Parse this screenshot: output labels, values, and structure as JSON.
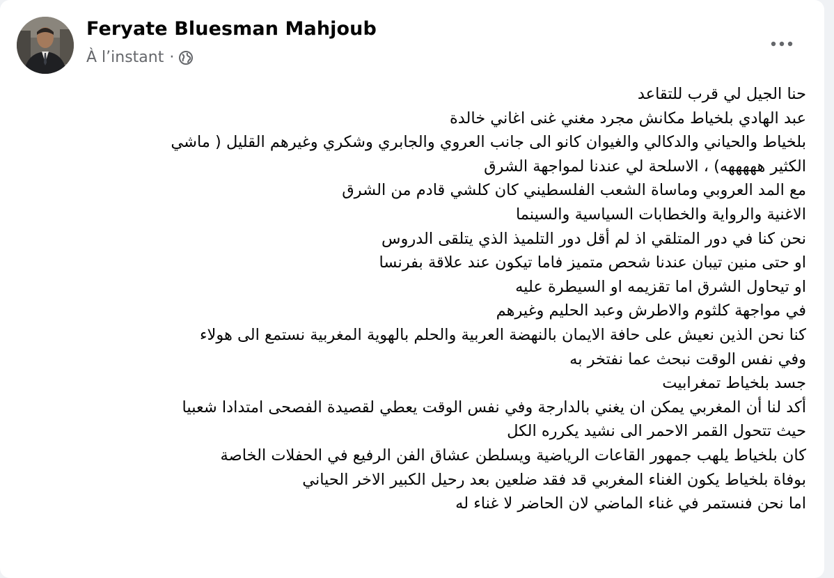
{
  "post": {
    "author": "Feryate Bluesman Mahjoub",
    "timestamp": "À l’instant",
    "separator": "·",
    "audience_icon": "globe-icon",
    "more_icon": "more-horizontal-icon",
    "lines": [
      "حنا الجيل لي قرب للتقاعد",
      "عبد الهادي بلخياط مكانش مجرد مغني غنى اغاني خالدة",
      "بلخياط والحياني والدكالي والغيوان كانو الى جانب العروي والجابري وشكري وغيرهم القليل ( ماشي",
      "الكثير هههههه)  ، الاسلحة لي عندنا لمواجهة الشرق",
      "مع المد العروبي وماساة الشعب الفلسطيني كان كلشي قادم من الشرق",
      "الاغنية والرواية والخطابات السياسية والسينما",
      "نحن كنا في دور المتلقي اذ لم أقل دور التلميذ الذي يتلقى الدروس",
      "او حتى منين تيبان عندنا شحص متميز  فاما تيكون عند علاقة بفرنسا",
      "او تيحاول الشرق اما تقزيمه او السيطرة عليه",
      "في مواجهة كلثوم والاطرش وعبد الحليم وغيرهم",
      "كنا نحن الذين نعيش  على حافة الايمان بالنهضة العربية والحلم بالهوية المغربية نستمع الى هولاء",
      "وفي نفس الوقت نبحث عما نفتخر به",
      "جسد بلخياط تمغرابيت",
      "أكد لنا أن المغربي يمكن ان يغني بالدارجة وفي نفس الوقت يعطي لقصيدة الفصحى امتدادا شعبيا",
      "حيث تتحول القمر الاحمر الى نشيد يكرره الكل",
      "كان بلخياط يلهب جمهور القاعات الرياضية ويسلطن عشاق الفن الرفيع في الحفلات الخاصة",
      "بوفاة بلخياط يكون الغناء المغربي قد فقد ضلعين بعد  رحيل الكبير الاخر الحياني",
      "اما نحن فنستمر في غناء الماضي لان الحاضر لا غناء له"
    ]
  }
}
